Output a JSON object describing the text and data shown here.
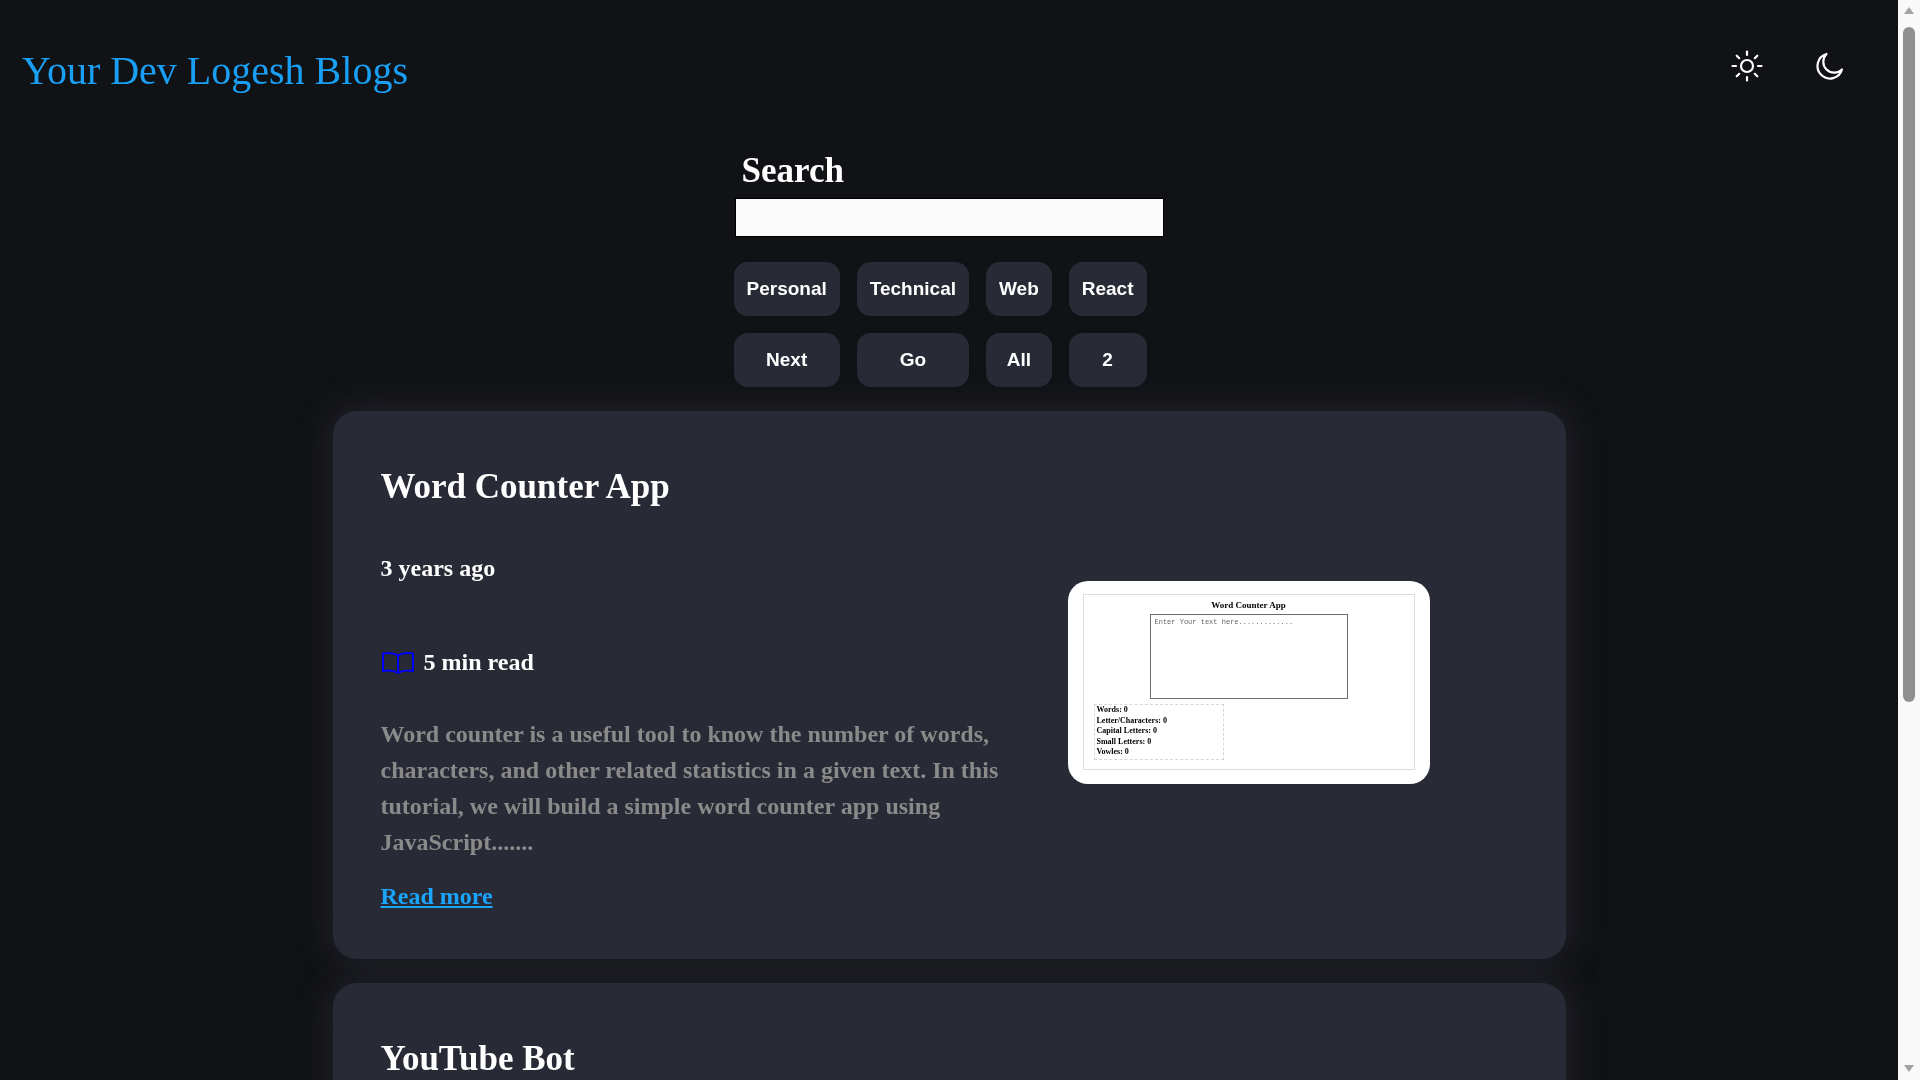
{
  "header": {
    "logo": "Your Dev Logesh Blogs"
  },
  "search": {
    "heading": "Search"
  },
  "category_buttons": [
    "Personal",
    "Technical",
    "Web",
    "React"
  ],
  "nav_buttons": [
    "Next",
    "Go",
    "All",
    "2"
  ],
  "posts": [
    {
      "title": "Word Counter App",
      "date": "3 years ago",
      "read_time": "5 min read",
      "excerpt": "Word counter is a useful tool to know the number of words, characters, and other related statistics in a given text. In this tutorial, we will build a simple word counter app using JavaScript.......",
      "link": "Read more",
      "screenshot": {
        "title": "Word Counter App",
        "placeholder": "Enter Your text here.............",
        "stats": [
          "Words: 0",
          "Letter/Characters: 0",
          "Capital Letters: 0",
          "Small Letters: 0",
          "Vowles: 0"
        ]
      }
    },
    {
      "title": "YouTube Bot"
    }
  ]
}
